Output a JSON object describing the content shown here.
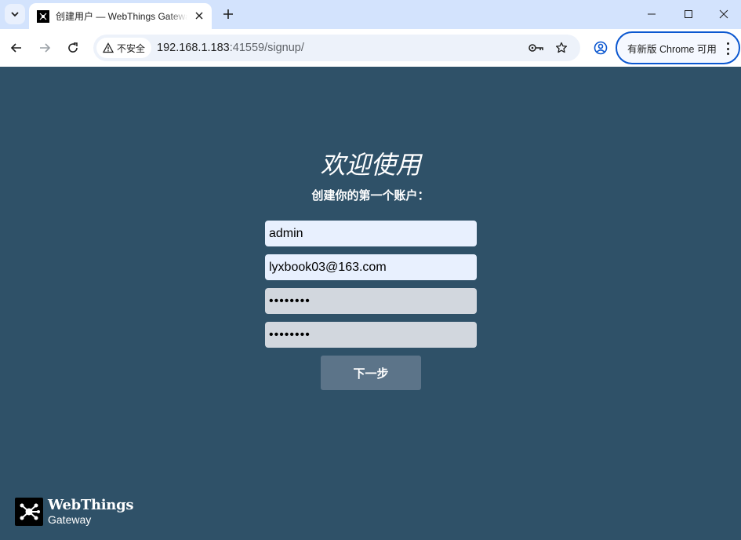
{
  "browser": {
    "tab": {
      "title": "创建用户 — WebThings Gateway"
    },
    "security_label": "不安全",
    "url": {
      "host": "192.168.1.183",
      "rest": ":41559/signup/"
    },
    "update_label": "有新版 Chrome 可用",
    "accent_color": "#0b57d0"
  },
  "icons": {
    "tab_search": "chevron-down-icon",
    "favicon": "webthings-icon",
    "close": "close-icon",
    "new_tab": "plus-icon",
    "back": "back-arrow-icon",
    "forward": "forward-arrow-icon",
    "reload": "reload-icon",
    "warning": "warning-icon",
    "password_key": "key-icon",
    "bookmark": "star-icon",
    "profile": "profile-icon",
    "menu": "more-vert-icon"
  },
  "page": {
    "background": "#2f5168",
    "welcome": "欢迎使用",
    "subtitle": "创建你的第一个账户：",
    "fields": {
      "name": "admin",
      "email": "lyxbook03@163.com",
      "password": "••••••••",
      "confirm_password": "••••••••"
    },
    "next_button": "下一步",
    "logo": {
      "name": "WebThings",
      "sub": "Gateway"
    }
  }
}
